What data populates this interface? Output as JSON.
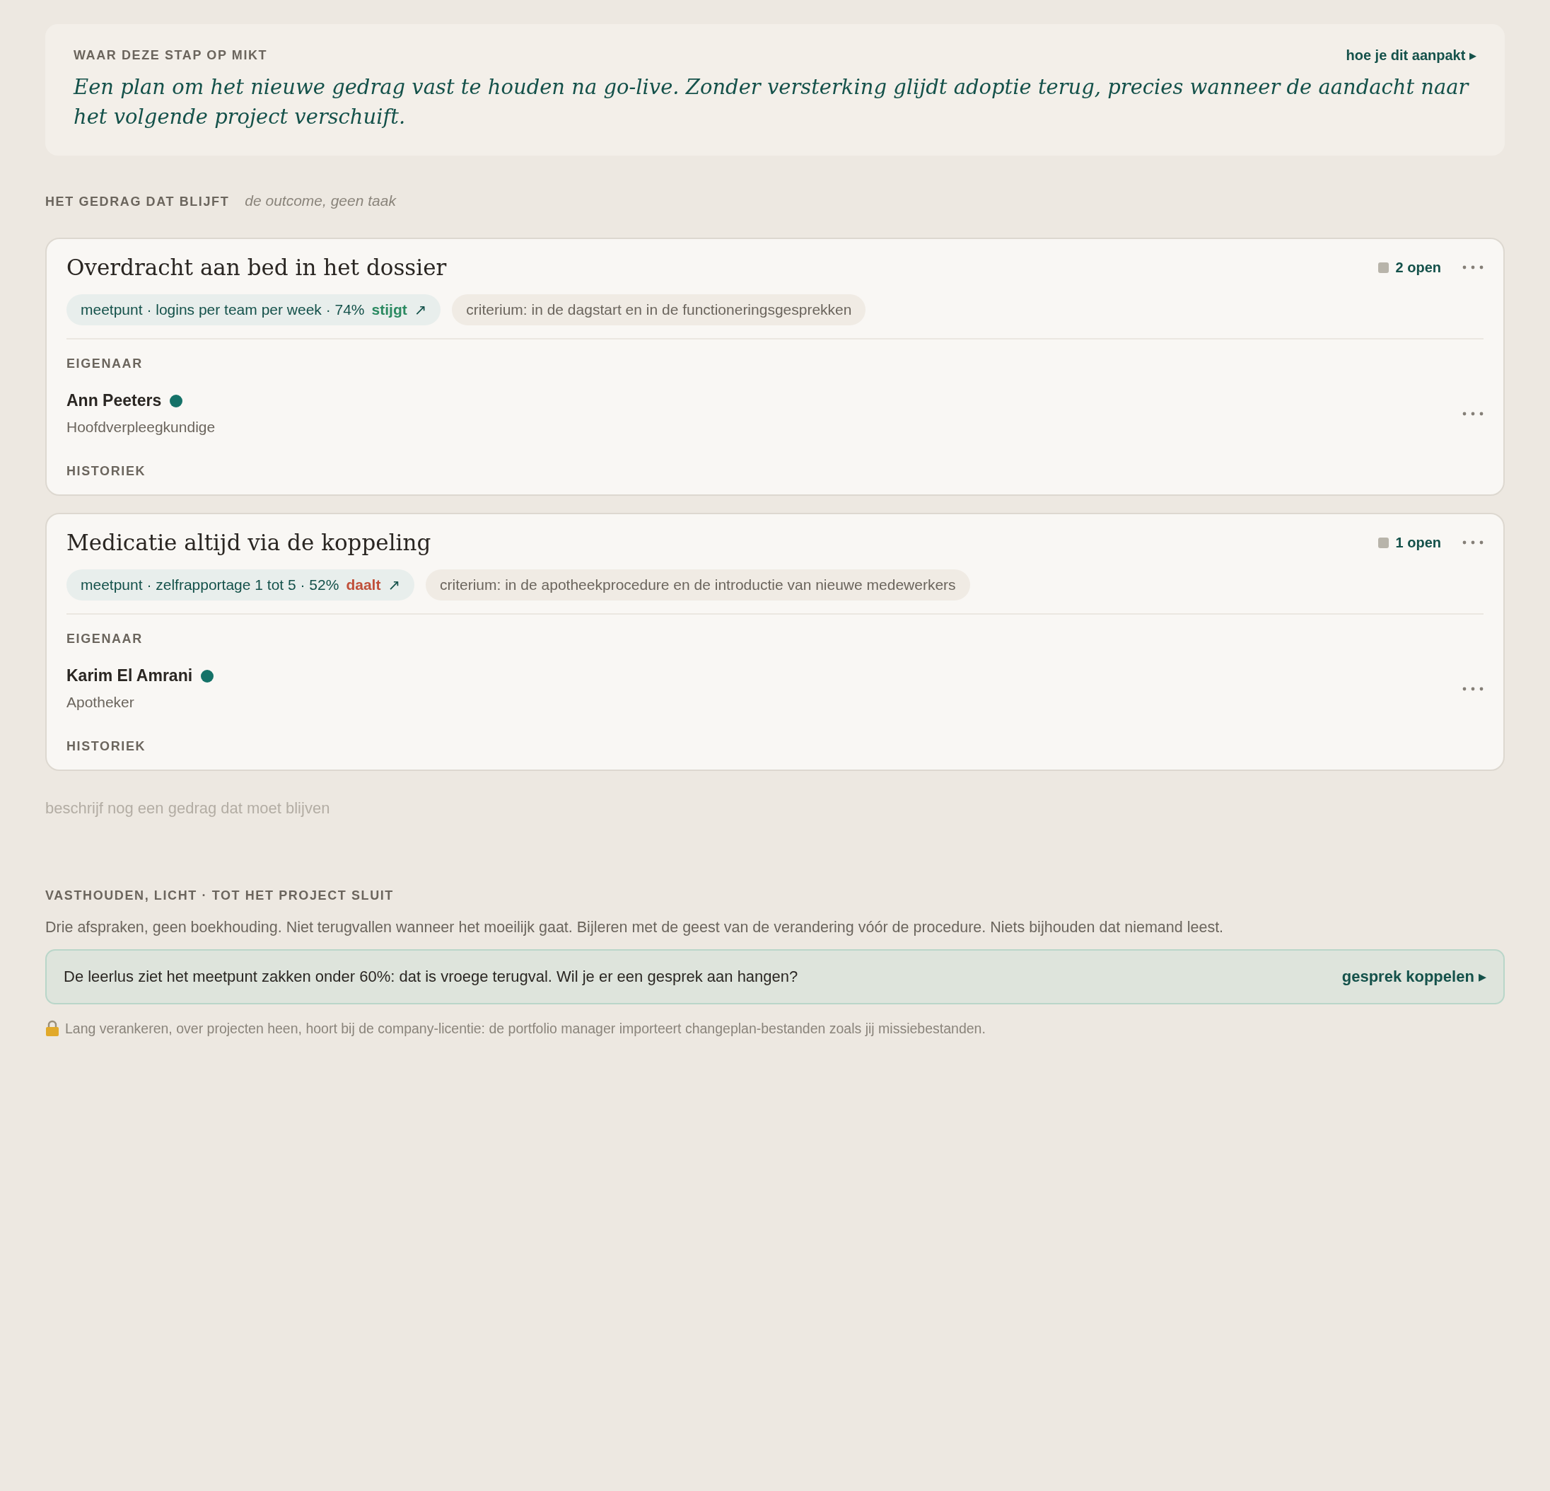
{
  "intro": {
    "label": "WAAR DEZE STAP OP MIKT",
    "link": "hoe je dit aanpakt ▸",
    "text": "Een plan om het nieuwe gedrag vast te houden na go-live. Zonder versterking glijdt adoptie terug, precies wanneer de aandacht naar het volgende project verschuift."
  },
  "section": {
    "label": "HET GEDRAG DAT BLIJFT",
    "hint": "de outcome, geen taak"
  },
  "behaviors": [
    {
      "title": "Overdracht aan bed in het dossier",
      "open": "2 open",
      "metric": "meetpunt · logins per team per week · 74%",
      "trend": {
        "kind": "up",
        "label": "stijgt",
        "arrow": "↗"
      },
      "criterion": "criterium: in de dagstart en in de functioneringsgesprekken",
      "owner_label": "EIGENAAR",
      "owner": {
        "name": "Ann Peeters",
        "color": "#157268",
        "role": "Hoofdverpleegkundige"
      },
      "history_label": "HISTORIEK"
    },
    {
      "title": "Medicatie altijd via de koppeling",
      "open": "1 open",
      "metric": "meetpunt · zelfrapportage 1 tot 5 · 52%",
      "trend": {
        "kind": "down",
        "label": "daalt",
        "arrow": "↗"
      },
      "criterion": "criterium: in de apotheekprocedure en de introductie van nieuwe medewerkers",
      "owner_label": "EIGENAAR",
      "owner": {
        "name": "Karim El Amrani",
        "color": "#157268",
        "role": "Apotheker"
      },
      "history_label": "HISTORIEK"
    }
  ],
  "new_behavior": {
    "placeholder": "beschrijf nog een gedrag dat moet blijven"
  },
  "sustain": {
    "label": "VASTHOUDEN, LICHT · TOT HET PROJECT SLUIT",
    "text": "Drie afspraken, geen boekhouding. Niet terugvallen wanneer het moeilijk gaat. Bijleren met de geest van de verandering vóór de procedure. Niets bijhouden dat niemand leest.",
    "alert": {
      "text": "De leerlus ziet het meetpunt zakken onder 60%: dat is vroege terugval. Wil je er een gesprek aan hangen?",
      "action": "gesprek koppelen ▸"
    },
    "note": "Lang verankeren, over projecten heen, hoort bij de company-licentie: de portfolio manager importeert changeplan-bestanden zoals jij missiebestanden."
  }
}
